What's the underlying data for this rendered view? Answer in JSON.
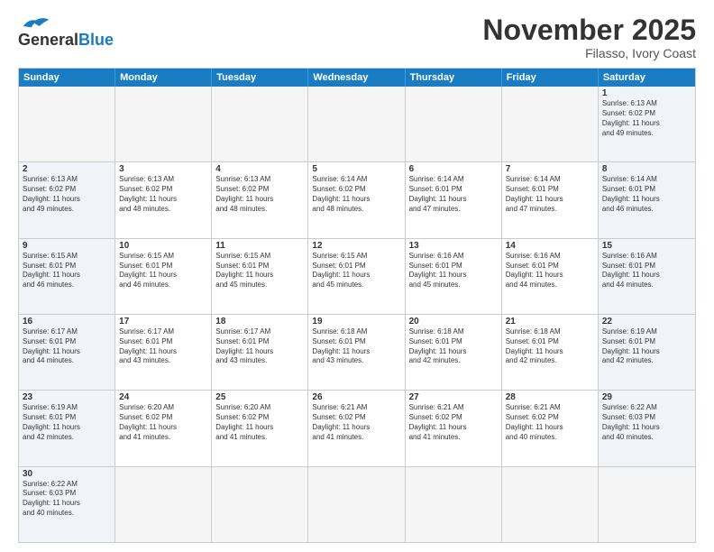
{
  "header": {
    "logo_general": "General",
    "logo_blue": "Blue",
    "month_title": "November 2025",
    "location": "Filasso, Ivory Coast"
  },
  "day_headers": [
    "Sunday",
    "Monday",
    "Tuesday",
    "Wednesday",
    "Thursday",
    "Friday",
    "Saturday"
  ],
  "rows": [
    {
      "cells": [
        {
          "day": "",
          "type": "empty",
          "info": ""
        },
        {
          "day": "",
          "type": "empty",
          "info": ""
        },
        {
          "day": "",
          "type": "empty",
          "info": ""
        },
        {
          "day": "",
          "type": "empty",
          "info": ""
        },
        {
          "day": "",
          "type": "empty",
          "info": ""
        },
        {
          "day": "",
          "type": "empty",
          "info": ""
        },
        {
          "day": "1",
          "type": "weekend",
          "info": "Sunrise: 6:13 AM\nSunset: 6:02 PM\nDaylight: 11 hours\nand 49 minutes."
        }
      ]
    },
    {
      "cells": [
        {
          "day": "2",
          "type": "weekend",
          "info": "Sunrise: 6:13 AM\nSunset: 6:02 PM\nDaylight: 11 hours\nand 49 minutes."
        },
        {
          "day": "3",
          "type": "normal",
          "info": "Sunrise: 6:13 AM\nSunset: 6:02 PM\nDaylight: 11 hours\nand 48 minutes."
        },
        {
          "day": "4",
          "type": "normal",
          "info": "Sunrise: 6:13 AM\nSunset: 6:02 PM\nDaylight: 11 hours\nand 48 minutes."
        },
        {
          "day": "5",
          "type": "normal",
          "info": "Sunrise: 6:14 AM\nSunset: 6:02 PM\nDaylight: 11 hours\nand 48 minutes."
        },
        {
          "day": "6",
          "type": "normal",
          "info": "Sunrise: 6:14 AM\nSunset: 6:01 PM\nDaylight: 11 hours\nand 47 minutes."
        },
        {
          "day": "7",
          "type": "normal",
          "info": "Sunrise: 6:14 AM\nSunset: 6:01 PM\nDaylight: 11 hours\nand 47 minutes."
        },
        {
          "day": "8",
          "type": "weekend",
          "info": "Sunrise: 6:14 AM\nSunset: 6:01 PM\nDaylight: 11 hours\nand 46 minutes."
        }
      ]
    },
    {
      "cells": [
        {
          "day": "9",
          "type": "weekend",
          "info": "Sunrise: 6:15 AM\nSunset: 6:01 PM\nDaylight: 11 hours\nand 46 minutes."
        },
        {
          "day": "10",
          "type": "normal",
          "info": "Sunrise: 6:15 AM\nSunset: 6:01 PM\nDaylight: 11 hours\nand 46 minutes."
        },
        {
          "day": "11",
          "type": "normal",
          "info": "Sunrise: 6:15 AM\nSunset: 6:01 PM\nDaylight: 11 hours\nand 45 minutes."
        },
        {
          "day": "12",
          "type": "normal",
          "info": "Sunrise: 6:15 AM\nSunset: 6:01 PM\nDaylight: 11 hours\nand 45 minutes."
        },
        {
          "day": "13",
          "type": "normal",
          "info": "Sunrise: 6:16 AM\nSunset: 6:01 PM\nDaylight: 11 hours\nand 45 minutes."
        },
        {
          "day": "14",
          "type": "normal",
          "info": "Sunrise: 6:16 AM\nSunset: 6:01 PM\nDaylight: 11 hours\nand 44 minutes."
        },
        {
          "day": "15",
          "type": "weekend",
          "info": "Sunrise: 6:16 AM\nSunset: 6:01 PM\nDaylight: 11 hours\nand 44 minutes."
        }
      ]
    },
    {
      "cells": [
        {
          "day": "16",
          "type": "weekend",
          "info": "Sunrise: 6:17 AM\nSunset: 6:01 PM\nDaylight: 11 hours\nand 44 minutes."
        },
        {
          "day": "17",
          "type": "normal",
          "info": "Sunrise: 6:17 AM\nSunset: 6:01 PM\nDaylight: 11 hours\nand 43 minutes."
        },
        {
          "day": "18",
          "type": "normal",
          "info": "Sunrise: 6:17 AM\nSunset: 6:01 PM\nDaylight: 11 hours\nand 43 minutes."
        },
        {
          "day": "19",
          "type": "normal",
          "info": "Sunrise: 6:18 AM\nSunset: 6:01 PM\nDaylight: 11 hours\nand 43 minutes."
        },
        {
          "day": "20",
          "type": "normal",
          "info": "Sunrise: 6:18 AM\nSunset: 6:01 PM\nDaylight: 11 hours\nand 42 minutes."
        },
        {
          "day": "21",
          "type": "normal",
          "info": "Sunrise: 6:18 AM\nSunset: 6:01 PM\nDaylight: 11 hours\nand 42 minutes."
        },
        {
          "day": "22",
          "type": "weekend",
          "info": "Sunrise: 6:19 AM\nSunset: 6:01 PM\nDaylight: 11 hours\nand 42 minutes."
        }
      ]
    },
    {
      "cells": [
        {
          "day": "23",
          "type": "weekend",
          "info": "Sunrise: 6:19 AM\nSunset: 6:01 PM\nDaylight: 11 hours\nand 42 minutes."
        },
        {
          "day": "24",
          "type": "normal",
          "info": "Sunrise: 6:20 AM\nSunset: 6:02 PM\nDaylight: 11 hours\nand 41 minutes."
        },
        {
          "day": "25",
          "type": "normal",
          "info": "Sunrise: 6:20 AM\nSunset: 6:02 PM\nDaylight: 11 hours\nand 41 minutes."
        },
        {
          "day": "26",
          "type": "normal",
          "info": "Sunrise: 6:21 AM\nSunset: 6:02 PM\nDaylight: 11 hours\nand 41 minutes."
        },
        {
          "day": "27",
          "type": "normal",
          "info": "Sunrise: 6:21 AM\nSunset: 6:02 PM\nDaylight: 11 hours\nand 41 minutes."
        },
        {
          "day": "28",
          "type": "normal",
          "info": "Sunrise: 6:21 AM\nSunset: 6:02 PM\nDaylight: 11 hours\nand 40 minutes."
        },
        {
          "day": "29",
          "type": "weekend",
          "info": "Sunrise: 6:22 AM\nSunset: 6:03 PM\nDaylight: 11 hours\nand 40 minutes."
        }
      ]
    },
    {
      "cells": [
        {
          "day": "30",
          "type": "weekend",
          "info": "Sunrise: 6:22 AM\nSunset: 6:03 PM\nDaylight: 11 hours\nand 40 minutes."
        },
        {
          "day": "",
          "type": "empty",
          "info": ""
        },
        {
          "day": "",
          "type": "empty",
          "info": ""
        },
        {
          "day": "",
          "type": "empty",
          "info": ""
        },
        {
          "day": "",
          "type": "empty",
          "info": ""
        },
        {
          "day": "",
          "type": "empty",
          "info": ""
        },
        {
          "day": "",
          "type": "empty",
          "info": ""
        }
      ]
    }
  ]
}
